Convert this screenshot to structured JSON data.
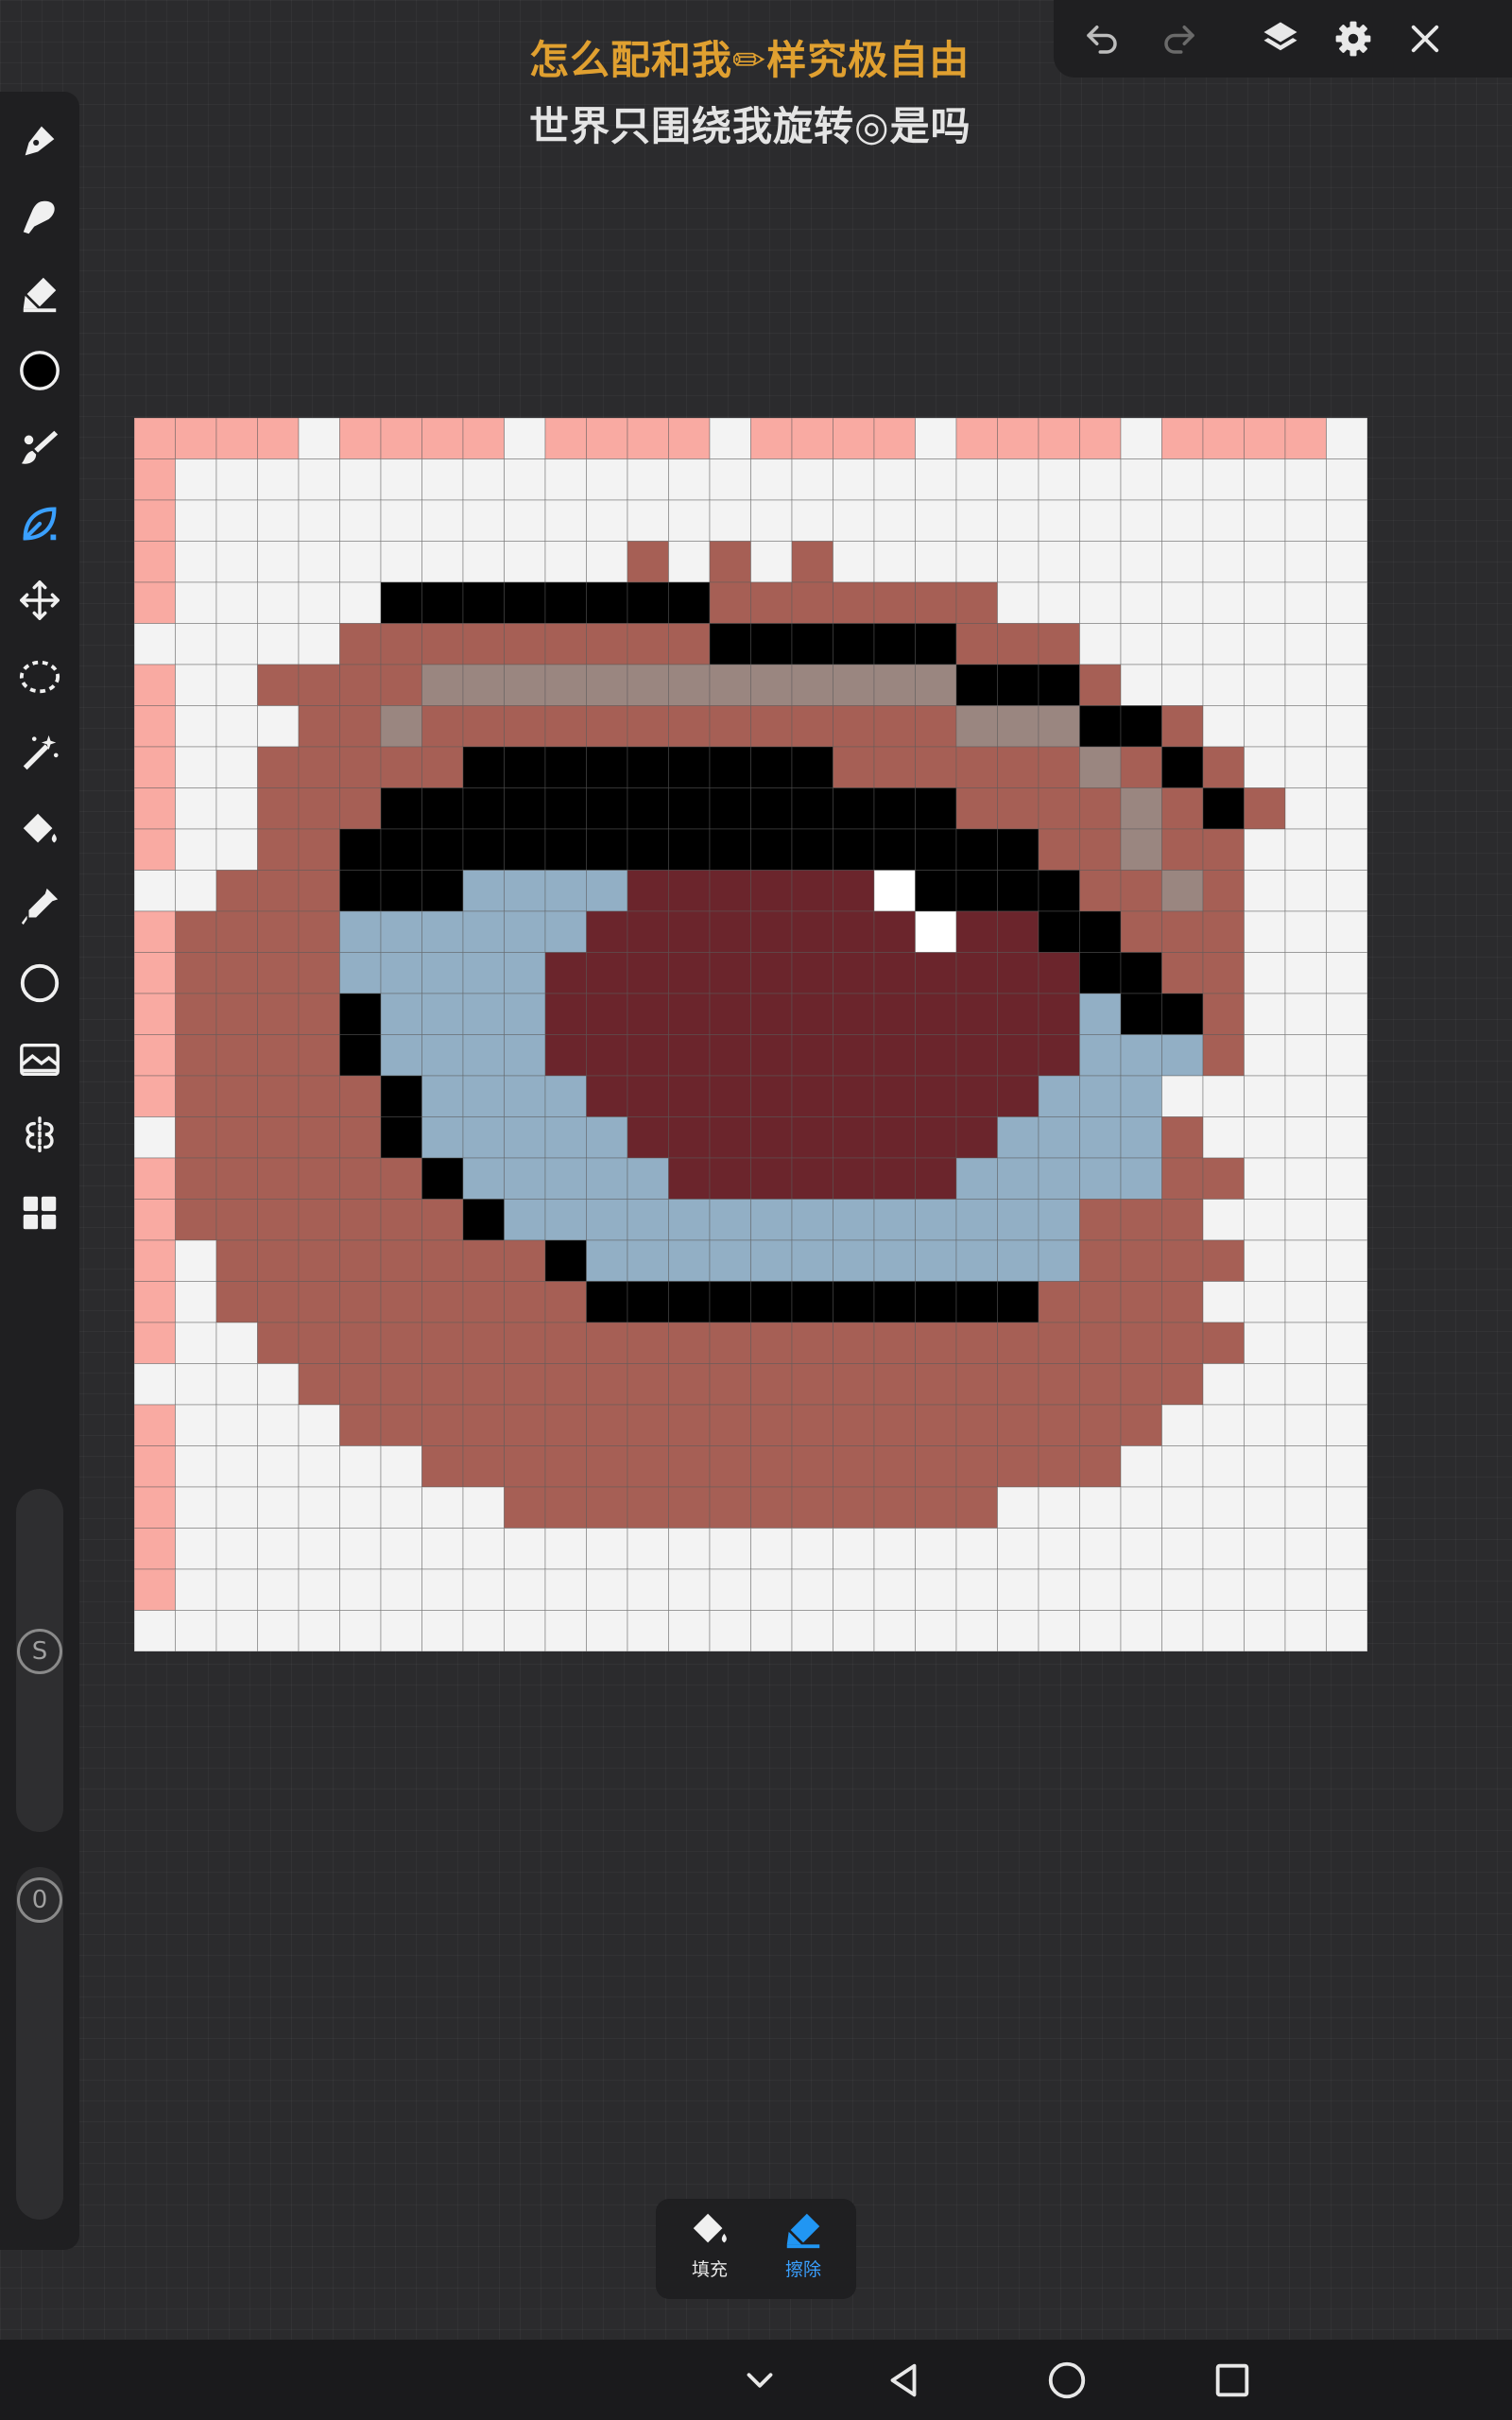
{
  "title": {
    "line1": "怎么配和我✏样究极自由",
    "line2": "世界只围绕我旋转◎是吗",
    "line1_color": "#e0a030",
    "line2_color": "#e4e4e4"
  },
  "top_toolbar": {
    "icons": [
      "undo-icon",
      "redo-icon",
      "layers-icon",
      "gear-icon",
      "close-icon"
    ]
  },
  "left_toolbar": {
    "tools": [
      "pen-icon",
      "smudge-icon",
      "eraser-icon",
      "color-swatch",
      "brush-icon",
      "leaf-pen-icon",
      "move-icon",
      "lasso-icon",
      "magic-wand-icon",
      "fill-bucket-icon",
      "eyedropper-icon",
      "circle-shape-icon",
      "image-icon",
      "symmetry-icon",
      "grid-icon"
    ],
    "active_tool": "leaf-pen-icon",
    "current_color": "#000000",
    "size_slider": {
      "label": "S"
    },
    "opacity_slider": {
      "label": "0"
    }
  },
  "bottom_panel": {
    "fill_label": "填充",
    "erase_label": "擦除",
    "active": "erase"
  },
  "system_nav": {
    "icons": [
      "chevron-down-icon",
      "back-icon",
      "home-icon",
      "recents-icon"
    ]
  },
  "canvas": {
    "grid_size": 30,
    "colors": {
      "W": "#f3f3f3",
      "P": "#f9aaa2",
      "R": "#a65f55",
      "K": "#000000",
      "G": "#9a8680",
      "B": "#92afc5",
      "D": "#6b252c",
      "H": "#ffffff"
    },
    "rows": [
      "PPPPWPPPPWPPPPWPPPPWPPPPWPPPPW",
      "PWWWWWWWWWWWWWWWWWWWWWWWWWWWWW",
      "PWWWWWWWWWWWWWWWWWWWWWWWWWWWWW",
      "PWWWWWWWWWWWRWRWRWWWWWWWWWWWWW",
      "PWWWWWKKKKKKKKRRRRRRRWWWWWWWWW",
      "WWWWWRRRRRRRRRKKKKKKRRRWWWWWWW",
      "PWWRRRRGGGGGGGGGGGGGKKKRWWWWWW",
      "PWWWRRGRRRRRRRRRRRRRGGGKKRWWWW",
      "PWWRRRRRKKKKKKKKKRRRRRRGRKRWWW",
      "PWWRRRKKKKKKKKKKKKKKRRRRGRKRWW",
      "PWWRRKKKKKKKKKKKKKKKKKRRGRRWWW",
      "WWRRRKKKBBBBDDDDDDHKKKKRRGRWWW",
      "PRRRRBBBBBBDDDDDDDDHDDKKRRRWWW",
      "PRRRRBBBBBDDDDDDDDDDDDDKKRRWWW",
      "PRRRRKBBBBDDDDDDDDDDDDDBKKRWWW",
      "PRRRRKBBBBDDDDDDDDDDDDDBBBRWWW",
      "PRRRRRKBBBBDDDDDDDDDDDBBBWWWWW",
      "WRRRRRKBBBBBDDDDDDDDDBBBBRWWWW",
      "PRRRRRRKBBBBBDDDDDDDBBBBBRRWWW",
      "PRRRRRRRKBBBBBBBBBBBBBBRRRWWWW",
      "PWRRRRRRRRKBBBBBBBBBBBBRRRRWWW",
      "PWRRRRRRRRRKKKKKKKKKKKRRRRWWWW",
      "PWWRRRRRRRRRRRRRRRRRRRRRRRRWWW",
      "WWWWRRRRRRRRRRRRRRRRRRRRRRWWWW",
      "PWWWWRRRRRRRRRRRRRRRRRRRRWWWWW",
      "PWWWWWWRRRRRRRRRRRRRRRRRWWWWWW",
      "PWWWWWWWWRRRRRRRRRRRRWWWWWWWWW",
      "PWWWWWWWWWWWWWWWWWWWWWWWWWWWWW",
      "PWWWWWWWWWWWWWWWWWWWWWWWWWWWWW",
      "WWWWWWWWWWWWWWWWWWWWWWWWWWWWWW"
    ]
  }
}
